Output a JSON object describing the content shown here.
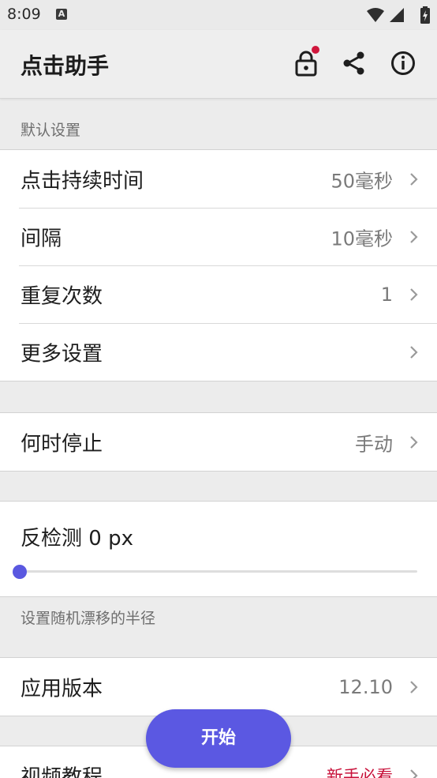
{
  "status_bar": {
    "time": "8:09",
    "notification_letter": "A"
  },
  "app_bar": {
    "title": "点击助手",
    "icons": [
      "lock-icon",
      "share-icon",
      "info-icon"
    ],
    "notification_dot_color": "#d0163c"
  },
  "default_section": {
    "label": "默认设置",
    "rows": [
      {
        "label": "点击持续时间",
        "value": "50毫秒"
      },
      {
        "label": "间隔",
        "value": "10毫秒"
      },
      {
        "label": "重复次数",
        "value": "1"
      },
      {
        "label": "更多设置",
        "value": ""
      }
    ]
  },
  "stop_row": {
    "label": "何时停止",
    "value": "手动"
  },
  "anti_detect": {
    "title": "反检测 0 px",
    "slider_value": 0,
    "hint": "设置随机漂移的半径"
  },
  "version_row": {
    "label": "应用版本",
    "value": "12.10"
  },
  "tutorial_row": {
    "label": "视频教程",
    "value": "新手必看"
  },
  "fab": {
    "label": "开始"
  },
  "colors": {
    "accent": "#5b58e2",
    "highlight": "#c8113a"
  }
}
